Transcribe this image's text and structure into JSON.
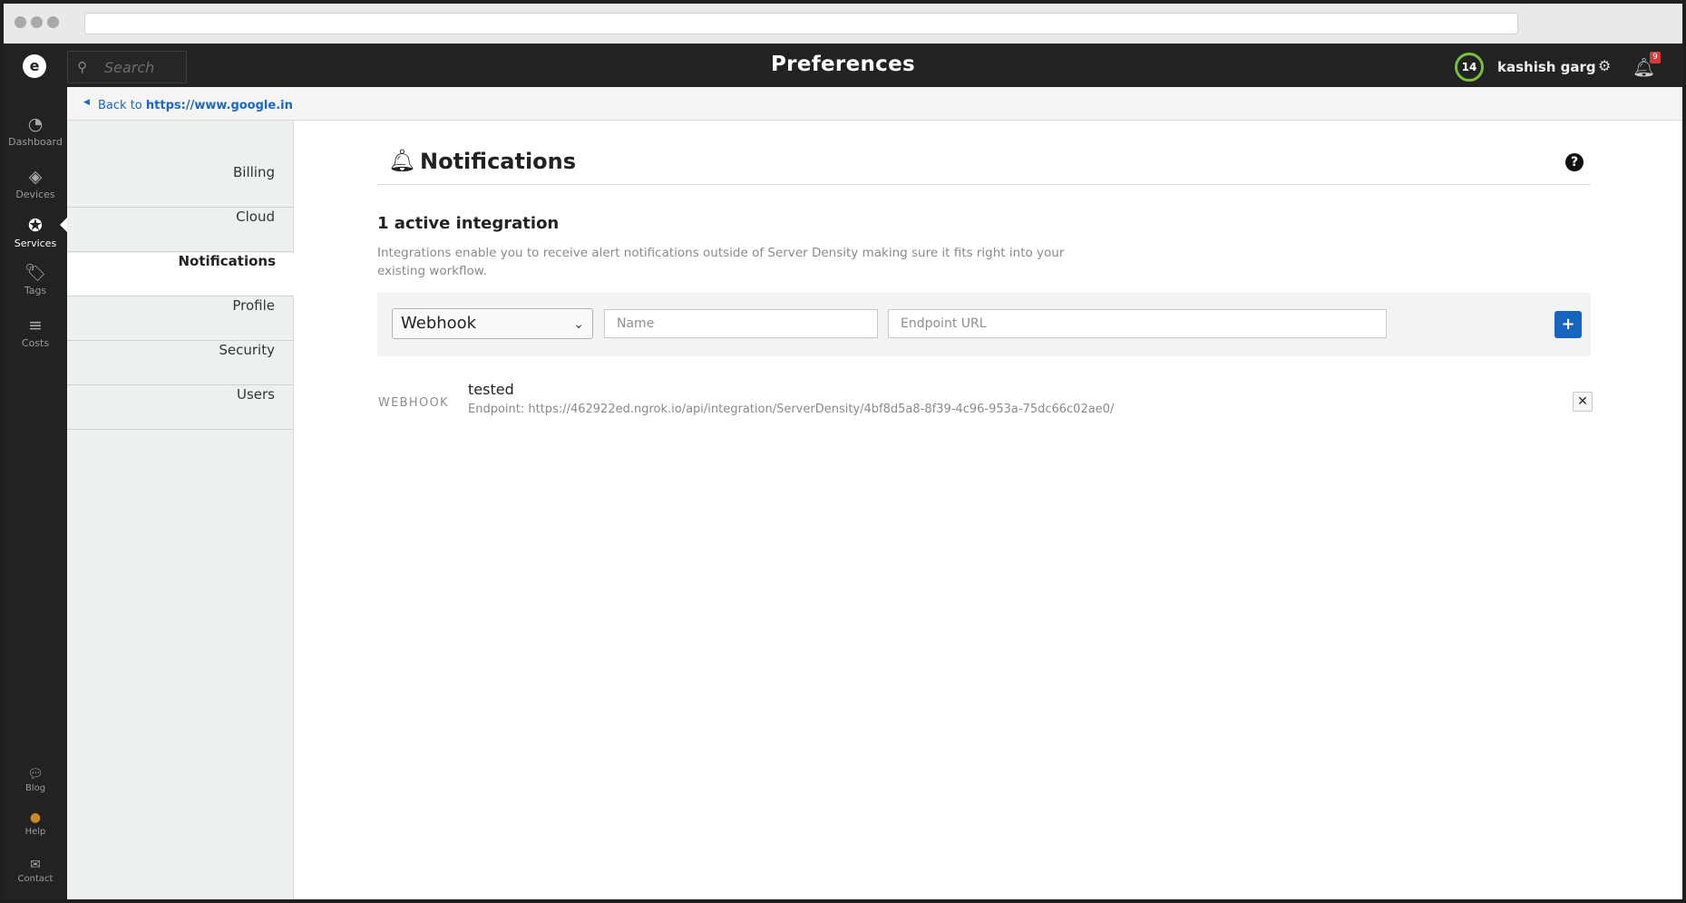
{
  "header": {
    "title": "Preferences",
    "search_placeholder": "Search",
    "count": "14",
    "user_name": "kashish garg",
    "notification_count": "9"
  },
  "rail": {
    "items": [
      {
        "label": "Dashboard",
        "icon": "dashboard-icon"
      },
      {
        "label": "Devices",
        "icon": "devices-icon"
      },
      {
        "label": "Services",
        "icon": "services-icon"
      },
      {
        "label": "Tags",
        "icon": "tag-icon"
      },
      {
        "label": "Costs",
        "icon": "costs-icon"
      }
    ],
    "bottom": [
      {
        "label": "Blog",
        "icon": "chat-icon"
      },
      {
        "label": "Help",
        "icon": "help-icon"
      },
      {
        "label": "Contact",
        "icon": "mail-icon"
      }
    ]
  },
  "back": {
    "prefix": "Back to",
    "link": "https://www.google.in"
  },
  "prefnav": {
    "items": [
      "Billing",
      "Cloud",
      "Notifications",
      "Profile",
      "Security",
      "Users"
    ]
  },
  "main": {
    "section_title": "Notifications",
    "active_count": "1 active integration",
    "description": "Integrations enable you to receive alert notifications outside of Server Density making sure it fits right into your existing workflow.",
    "form": {
      "type_selected": "Webhook",
      "name_placeholder": "Name",
      "endpoint_placeholder": "Endpoint URL",
      "add_label": "+"
    },
    "integration": {
      "type": "WEBHOOK",
      "name": "tested",
      "endpoint": "Endpoint: https://462922ed.ngrok.io/api/integration/ServerDensity/4bf8d5a8-8f39-4c96-953a-75dc66c02ae0/",
      "remove_label": "✕"
    }
  },
  "colors": {
    "accent": "#1565c0",
    "link": "#1a68c4",
    "status_ring": "#7cbd3a",
    "badge": "#d23b3b"
  }
}
